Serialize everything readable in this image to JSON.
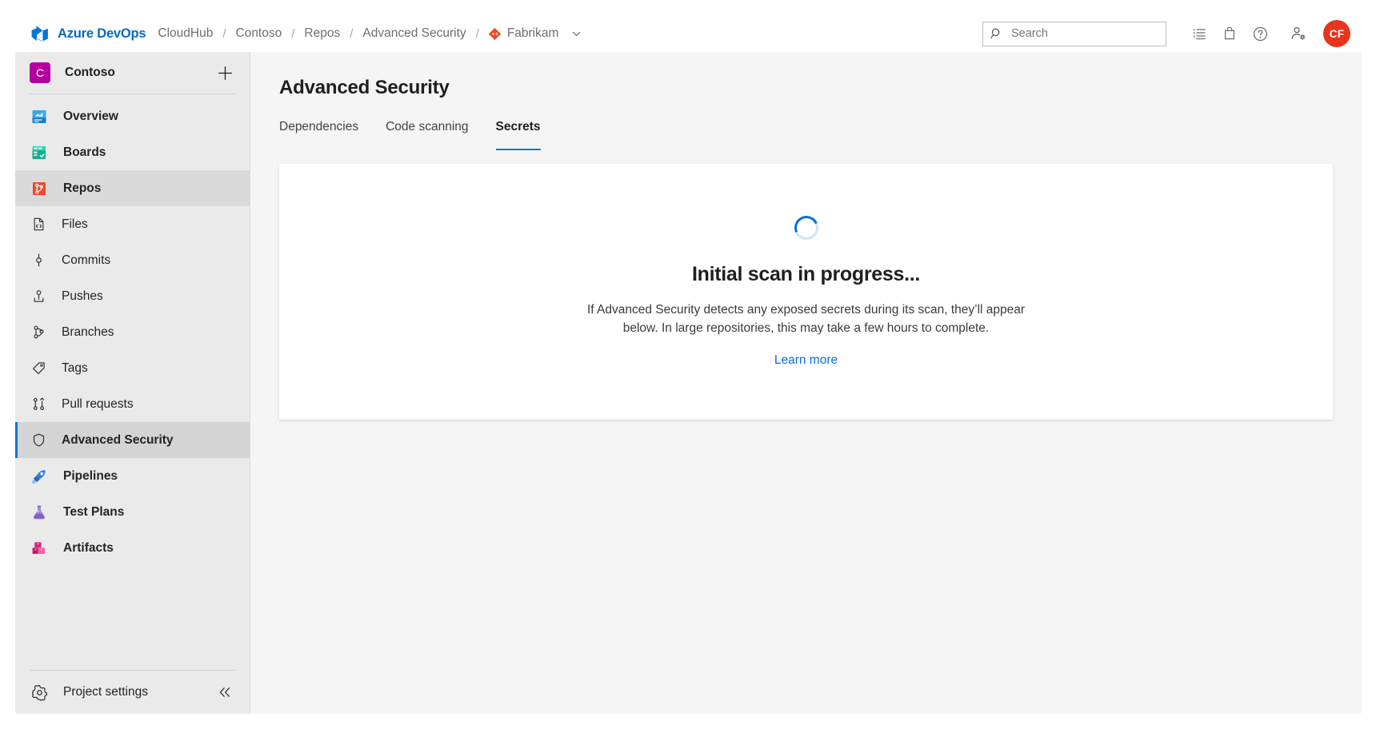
{
  "header": {
    "logo_icon": "azure-devops-logo",
    "brand": "Azure DevOps",
    "breadcrumbs": [
      {
        "label": "CloudHub"
      },
      {
        "label": "Contoso"
      },
      {
        "label": "Repos"
      },
      {
        "label": "Advanced Security"
      }
    ],
    "separator": "/",
    "repo": {
      "name": "Fabrikam",
      "icon": "git-repository-icon",
      "chevron": "chevron-down-icon"
    },
    "search": {
      "placeholder": "Search",
      "value": "",
      "icon": "search-icon"
    },
    "actions": [
      {
        "name": "backlog-icon",
        "title": "Work items"
      },
      {
        "name": "marketplace-bag-icon",
        "title": "Marketplace"
      },
      {
        "name": "help-icon",
        "title": "Help"
      },
      {
        "name": "user-settings-icon",
        "title": "User settings"
      }
    ],
    "avatar": {
      "initials": "CF",
      "color": "#e8341c"
    }
  },
  "sidebar": {
    "project": {
      "name": "Contoso",
      "badge_letter": "C",
      "badge_color": "#b4009e"
    },
    "add_button": {
      "name": "add-icon",
      "label": "+"
    },
    "items": [
      {
        "label": "Overview",
        "icon": "overview-icon",
        "kind": "hub",
        "selected": false
      },
      {
        "label": "Boards",
        "icon": "boards-icon",
        "kind": "hub",
        "selected": false
      },
      {
        "label": "Repos",
        "icon": "repos-icon",
        "kind": "hub",
        "selected": true
      },
      {
        "label": "Files",
        "icon": "files-icon",
        "kind": "sub",
        "selected": false
      },
      {
        "label": "Commits",
        "icon": "commits-icon",
        "kind": "sub",
        "selected": false
      },
      {
        "label": "Pushes",
        "icon": "pushes-icon",
        "kind": "sub",
        "selected": false
      },
      {
        "label": "Branches",
        "icon": "branches-icon",
        "kind": "sub",
        "selected": false
      },
      {
        "label": "Tags",
        "icon": "tags-icon",
        "kind": "sub",
        "selected": false
      },
      {
        "label": "Pull requests",
        "icon": "pull-requests-icon",
        "kind": "sub",
        "selected": false
      },
      {
        "label": "Advanced Security",
        "icon": "shield-icon",
        "kind": "sub",
        "selected": true
      },
      {
        "label": "Pipelines",
        "icon": "pipelines-icon",
        "kind": "hub",
        "selected": false
      },
      {
        "label": "Test Plans",
        "icon": "test-plans-icon",
        "kind": "hub",
        "selected": false
      },
      {
        "label": "Artifacts",
        "icon": "artifacts-icon",
        "kind": "hub",
        "selected": false
      }
    ],
    "footer": {
      "label": "Project settings",
      "icon": "gear-icon",
      "collapse_icon": "chevron-double-left-icon"
    }
  },
  "main": {
    "title": "Advanced Security",
    "tabs": [
      {
        "label": "Dependencies",
        "active": false
      },
      {
        "label": "Code scanning",
        "active": false
      },
      {
        "label": "Secrets",
        "active": true
      }
    ],
    "card": {
      "spinner": "loading-spinner",
      "title": "Initial scan in progress...",
      "description": "If Advanced Security detects any exposed secrets during its scan, they’ll appear below. In large repositories, this may take a few hours to complete.",
      "link": "Learn more"
    }
  },
  "colors": {
    "accent": "#0078d4",
    "link": "#0a6ed1",
    "brand": "#0a67c2",
    "sidebar_bg": "#eaeaea",
    "main_bg": "#f5f5f5"
  }
}
